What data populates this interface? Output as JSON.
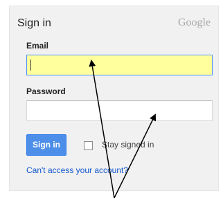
{
  "header": {
    "title": "Sign in",
    "brand": "Google"
  },
  "form": {
    "email_label": "Email",
    "email_value": "",
    "password_label": "Password",
    "password_value": "",
    "submit_label": "Sign in",
    "stay_signed_in_label": "Stay signed in",
    "stay_signed_in_checked": false,
    "help_link": "Can't access your account?"
  },
  "annotations": {
    "arrow_color": "#000000"
  }
}
